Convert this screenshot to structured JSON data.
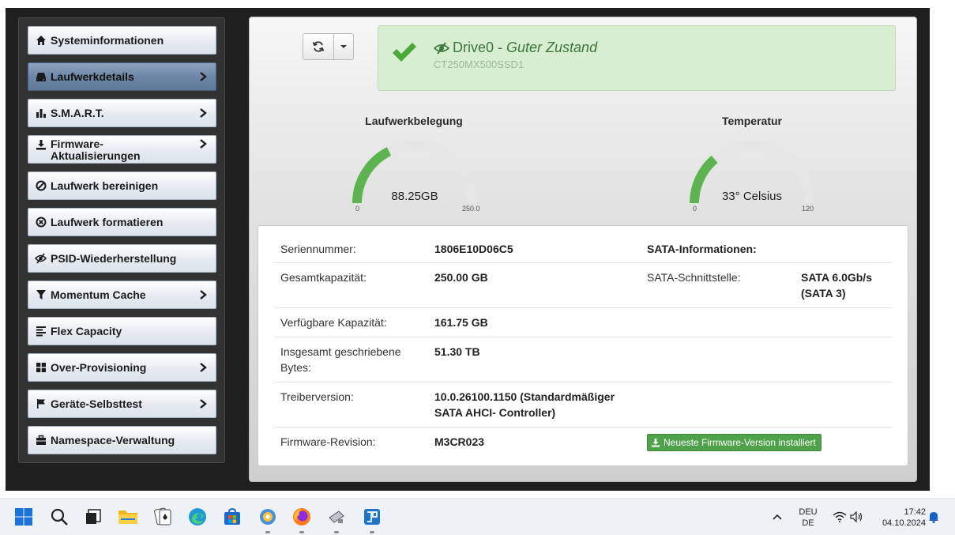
{
  "sidebar": {
    "items": [
      {
        "label": "Systeminformationen",
        "icon": "home-icon",
        "chevron": false
      },
      {
        "label": "Laufwerkdetails",
        "icon": "drive-icon",
        "chevron": true,
        "active": true
      },
      {
        "label": "S.M.A.R.T.",
        "icon": "bar-chart-icon",
        "chevron": true
      },
      {
        "label": "Firmware-Aktualisierungen",
        "label_line1": "Firmware-",
        "label_line2": "Aktualisierungen",
        "icon": "download-icon",
        "chevron": true
      },
      {
        "label": "Laufwerk bereinigen",
        "icon": "ban-icon",
        "chevron": false
      },
      {
        "label": "Laufwerk formatieren",
        "icon": "circle-x-icon",
        "chevron": false
      },
      {
        "label": "PSID-Wiederherstellung",
        "icon": "eye-slash-icon",
        "chevron": false
      },
      {
        "label": "Momentum Cache",
        "icon": "filter-icon",
        "chevron": true
      },
      {
        "label": "Flex Capacity",
        "icon": "align-left-icon",
        "chevron": false
      },
      {
        "label": "Over-Provisioning",
        "icon": "grid-icon",
        "chevron": true
      },
      {
        "label": "Geräte-Selbsttest",
        "icon": "flag-icon",
        "chevron": true
      },
      {
        "label": "Namespace-Verwaltung",
        "icon": "briefcase-icon",
        "chevron": false
      }
    ]
  },
  "status": {
    "drive": "Drive0",
    "separator": " - ",
    "state": "Guter Zustand",
    "model": "CT250MX500SSD1",
    "color": "#3c763d"
  },
  "gauges": {
    "usage": {
      "title": "Laufwerkbelegung",
      "value_label": "88.25GB",
      "value": 88.25,
      "min": "0",
      "max": "250.0",
      "max_value": 250.0
    },
    "temperature": {
      "title": "Temperatur",
      "value_label": "33° Celsius",
      "value": 33,
      "min": "0",
      "max": "120",
      "max_value": 120
    }
  },
  "details": {
    "serial_label": "Seriennummer:",
    "serial_value": "1806E10D06C5",
    "sata_info_label": "SATA-Informationen:",
    "capacity_label": "Gesamtkapazität:",
    "capacity_value": "250.00 GB",
    "sata_iface_label": "SATA-Schnittstelle:",
    "sata_iface_line1": "SATA 6.0Gb/s",
    "sata_iface_line2": "(SATA 3)",
    "available_label": "Verfügbare Kapazität:",
    "available_value": "161.75 GB",
    "written_label_line1": "Insgesamt geschriebene",
    "written_label_line2": "Bytes:",
    "written_value": "51.30 TB",
    "driver_label": "Treiberversion:",
    "driver_line1": "10.0.26100.1150 (Standardmäßiger",
    "driver_line2": "SATA AHCI- Controller)",
    "firmware_label": "Firmware-Revision:",
    "firmware_value": "M3CR023",
    "firmware_badge": "Neueste Firmware-Version installiert"
  },
  "taskbar": {
    "lang_line1": "DEU",
    "lang_line2": "DE",
    "time": "17:42",
    "date": "04.10.2024"
  },
  "colors": {
    "accent_green": "#5cb34f",
    "gauge_track": "#e6e6e6"
  }
}
